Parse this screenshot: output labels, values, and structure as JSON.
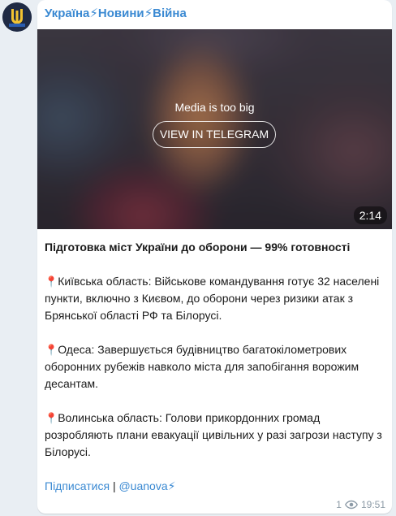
{
  "channel": {
    "name": "Україна⚡Новини⚡Війна"
  },
  "media": {
    "notice": "Media is too big",
    "button_label": "VIEW IN TELEGRAM",
    "duration": "2:14"
  },
  "post": {
    "title": "Підготовка міст України до оборони — 99% готовності",
    "paragraphs": [
      "Київська область: Військове командування готує 32 населені пункти, включно з Києвом, до оборони через ризики атак з Брянської області РФ та Білорусі.",
      "Одеса: Завершується будівництво багатокілометрових оборонних рубежів навколо міста для запобігання ворожим десантам.",
      "Волинська область: Голови прикордонних громад розробляють плани евакуації цивільних у разі загрози наступу з Білорусі."
    ],
    "pin_icon": "📍",
    "subscribe_label": "Підписатися",
    "separator": "|",
    "handle": "@uanova",
    "handle_suffix": "⚡"
  },
  "meta": {
    "views": "1",
    "time": "19:51"
  },
  "colors": {
    "link": "#3a89d2",
    "background": "#e9eef3",
    "bubble": "#ffffff"
  }
}
